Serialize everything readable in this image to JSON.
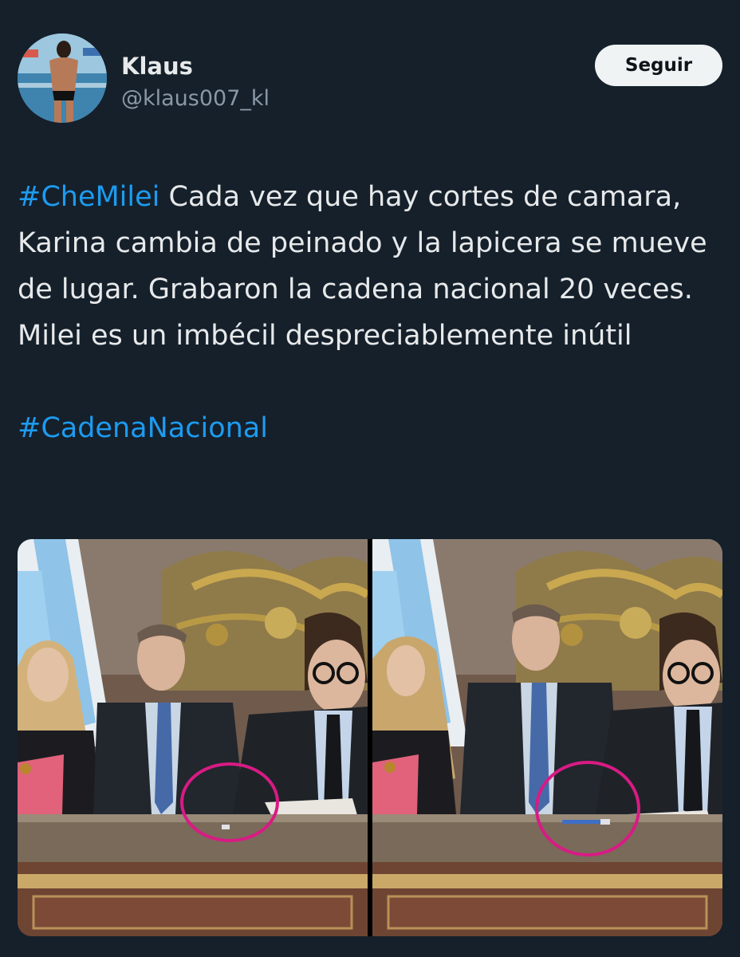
{
  "author": {
    "name": "Klaus",
    "handle": "@klaus007_kl"
  },
  "follow_button": {
    "label": "Seguir"
  },
  "tweet": {
    "hashtag_1": "#CheMilei",
    "body": " Cada vez que hay cortes de camara, Karina cambia de peinado y la lapicera se mueve de lugar. Grabaron la cadena nacional 20 veces. Milei es un imbécil despreciablemente inútil",
    "hashtag_2": "#CadenaNacional"
  },
  "colors": {
    "background": "#15202b",
    "link": "#1d9bf0",
    "text": "#e7e9ea",
    "secondary_text": "#8b98a5",
    "circle_annotation": "#d81b84"
  },
  "media": {
    "images": [
      "left-frame",
      "right-frame"
    ]
  }
}
